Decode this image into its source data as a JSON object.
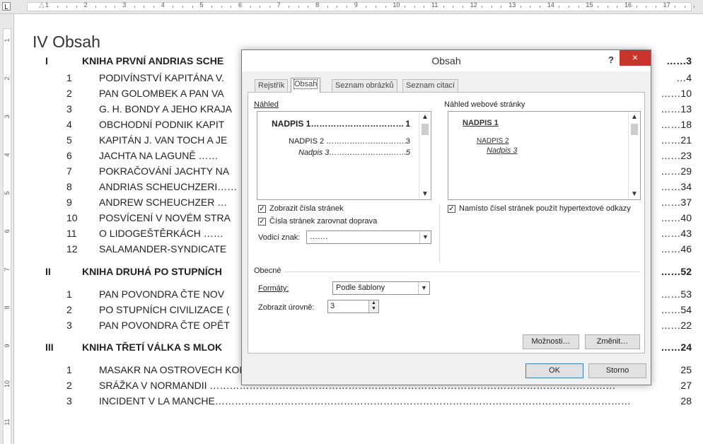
{
  "ruler": {
    "numbers": [
      "1",
      "2",
      "3",
      "4",
      "5",
      "6",
      "7",
      "8",
      "9",
      "10",
      "11",
      "12",
      "13",
      "14",
      "15",
      "16",
      "17"
    ],
    "vertical_numbers": [
      "1",
      "2",
      "3",
      "4",
      "5",
      "6",
      "7",
      "8",
      "9",
      "10",
      "11"
    ]
  },
  "document": {
    "heading": "IV Obsah",
    "toc": [
      {
        "num": "I",
        "title": "KNIHA PRVNÍ ANDRIAS SCHE",
        "page": "……3",
        "bold": true
      },
      {
        "num": "1",
        "title": "PODIVÍNSTVÍ KAPITÁNA V.",
        "page": "…4"
      },
      {
        "num": "2",
        "title": "PAN GOLOMBEK A PAN VA",
        "page": "……10"
      },
      {
        "num": "3",
        "title": "G. H. BONDY A JEHO KRAJA",
        "page": "……13"
      },
      {
        "num": "4",
        "title": "OBCHODNÍ PODNIK KAPIT",
        "page": "……18"
      },
      {
        "num": "5",
        "title": "KAPITÁN J. VAN TOCH A JE",
        "page": "……21"
      },
      {
        "num": "6",
        "title": "JACHTA NA LAGUNĚ ……",
        "page": "……23"
      },
      {
        "num": "7",
        "title": "POKRAČOVÁNÍ JACHTY NA",
        "page": "……29"
      },
      {
        "num": "8",
        "title": "ANDRIAS SCHEUCHZERI……",
        "page": "……34"
      },
      {
        "num": "9",
        "title": "ANDREW SCHEUCHZER …",
        "page": "……37"
      },
      {
        "num": "10",
        "title": "POSVÍCENÍ V NOVÉM STRA",
        "page": "……40"
      },
      {
        "num": "11",
        "title": "O LIDOGEŠTĚRKÁCH ……",
        "page": "……43"
      },
      {
        "num": "12",
        "title": "SALAMANDER-SYNDICATE",
        "page": "……46"
      },
      {
        "num": "II",
        "title": "KNIHA DRUHÁ PO STUPNÍCH",
        "page": "……52",
        "bold": true
      },
      {
        "num": "1",
        "title": "PAN POVONDRA ČTE NOV",
        "page": "……53"
      },
      {
        "num": "2",
        "title": "PO STUPNÍCH CIVILIZACE (",
        "page": "……54"
      },
      {
        "num": "3",
        "title": "PAN POVONDRA ČTE OPĚT",
        "page": "……22"
      },
      {
        "num": "III",
        "title": "KNIHA TŘETÍ VÁLKA S MLOK",
        "page": "……24",
        "bold": true
      },
      {
        "num": "1",
        "title": "MASAKR NA OSTROVECH KOKOSOVÝCH……………………………………………………………………………………………",
        "page": "25"
      },
      {
        "num": "2",
        "title": "SRÁŽKA V NORMANDII ……………………………………………………………………………………………………………",
        "page": "27"
      },
      {
        "num": "3",
        "title": "INCIDENT V LA MANCHE………………………………………………………………………………………………………………",
        "page": "28"
      }
    ]
  },
  "dialog": {
    "title": "Obsah",
    "help": "?",
    "close": "×",
    "tabs": [
      "Rejstřík",
      "Obsah",
      "Seznam obrázků",
      "Seznam citací"
    ],
    "print_preview": {
      "label": "Náhled",
      "lines": [
        {
          "text": "NADPIS 1……………………………",
          "page": "1"
        },
        {
          "text": "NADPIS 2 ……………………………",
          "page": "3"
        },
        {
          "text": "Nadpis 3…………………………",
          "page": "5"
        }
      ]
    },
    "web_preview": {
      "label": "Náhled webové stránky",
      "lines": [
        "NADPIS 1",
        "NADPIS 2",
        "Nadpis 3"
      ]
    },
    "show_page_numbers": {
      "label": "Zobrazit čísla stránek",
      "checked": true
    },
    "right_align": {
      "label": "Čísla stránek zarovnat doprava",
      "checked": true
    },
    "leader": {
      "label": "Vodicí znak:",
      "value": "……."
    },
    "hyperlinks": {
      "label": "Namísto čísel stránek použít hypertextové odkazy",
      "checked": true
    },
    "general_label": "Obecné",
    "formats": {
      "label": "Formáty:",
      "value": "Podle šablony"
    },
    "levels": {
      "label": "Zobrazit úrovně:",
      "value": "3"
    },
    "buttons": {
      "options": "Možnosti…",
      "modify": "Změnit…",
      "ok": "OK",
      "cancel": "Storno"
    }
  }
}
